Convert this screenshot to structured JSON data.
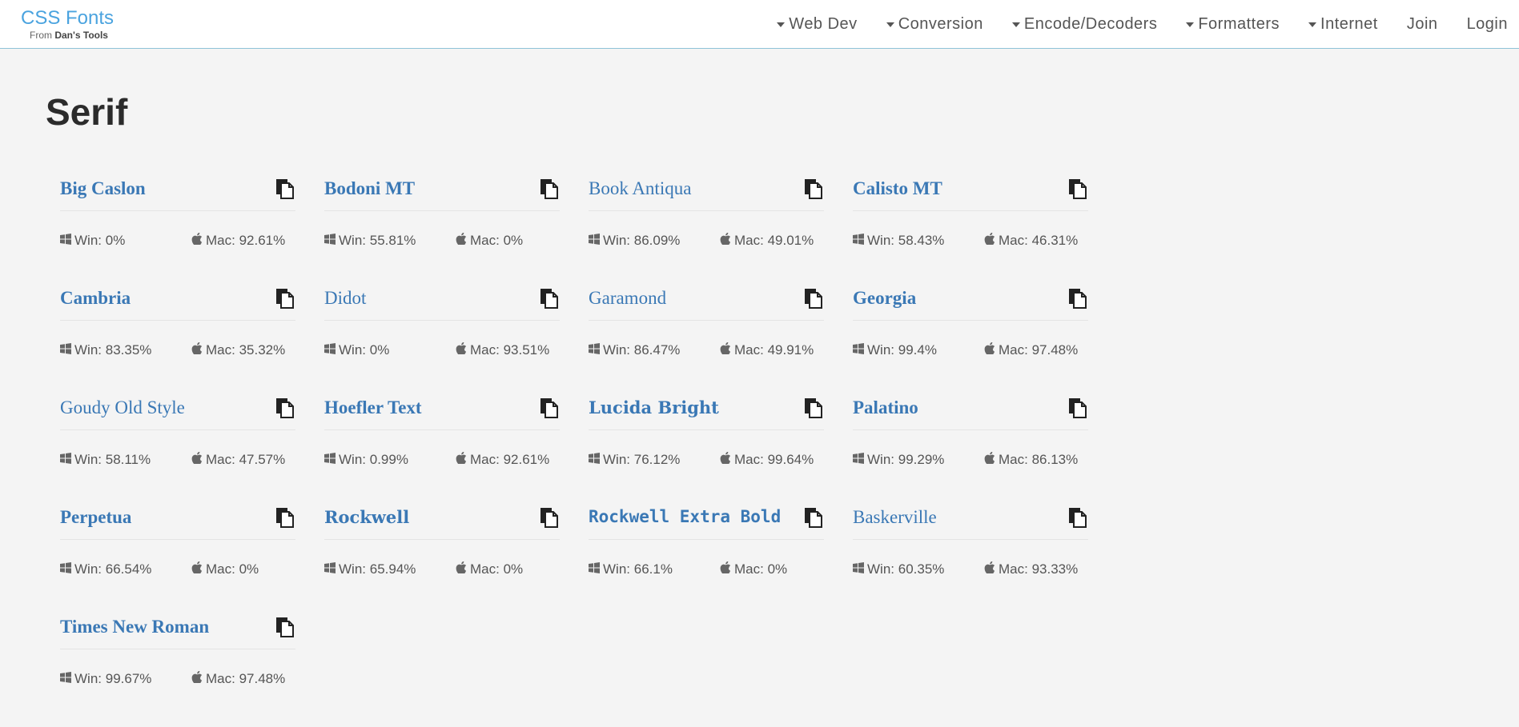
{
  "brand": {
    "title": "CSS Fonts",
    "from": "From",
    "site": "Dan's Tools"
  },
  "nav": [
    {
      "label": "Web Dev",
      "dropdown": true
    },
    {
      "label": "Conversion",
      "dropdown": true
    },
    {
      "label": "Encode/Decoders",
      "dropdown": true
    },
    {
      "label": "Formatters",
      "dropdown": true
    },
    {
      "label": "Internet",
      "dropdown": true
    },
    {
      "label": "Join",
      "dropdown": false
    },
    {
      "label": "Login",
      "dropdown": false
    }
  ],
  "page": {
    "title": "Serif"
  },
  "stat_labels": {
    "win": "Win:",
    "mac": "Mac:"
  },
  "fonts": [
    {
      "name": "Big Caslon",
      "win": "0%",
      "mac": "92.61%",
      "style": "f-serif"
    },
    {
      "name": "Bodoni MT",
      "win": "55.81%",
      "mac": "0%",
      "style": "f-serif"
    },
    {
      "name": "Book Antiqua",
      "win": "86.09%",
      "mac": "49.01%",
      "style": "f-serif-n"
    },
    {
      "name": "Calisto MT",
      "win": "58.43%",
      "mac": "46.31%",
      "style": "f-serif"
    },
    {
      "name": "Cambria",
      "win": "83.35%",
      "mac": "35.32%",
      "style": "f-serif"
    },
    {
      "name": "Didot",
      "win": "0%",
      "mac": "93.51%",
      "style": "f-serif-n"
    },
    {
      "name": "Garamond",
      "win": "86.47%",
      "mac": "49.91%",
      "style": "f-serif-n"
    },
    {
      "name": "Georgia",
      "win": "99.4%",
      "mac": "97.48%",
      "style": "f-serif"
    },
    {
      "name": "Goudy Old Style",
      "win": "58.11%",
      "mac": "47.57%",
      "style": "f-serif-n"
    },
    {
      "name": "Hoefler Text",
      "win": "0.99%",
      "mac": "92.61%",
      "style": "f-serif"
    },
    {
      "name": "Lucida Bright",
      "win": "76.12%",
      "mac": "99.64%",
      "style": "f-dserif-b"
    },
    {
      "name": "Palatino",
      "win": "99.29%",
      "mac": "86.13%",
      "style": "f-serif"
    },
    {
      "name": "Perpetua",
      "win": "66.54%",
      "mac": "0%",
      "style": "f-serif"
    },
    {
      "name": "Rockwell",
      "win": "65.94%",
      "mac": "0%",
      "style": "f-dserif-b"
    },
    {
      "name": "Rockwell Extra Bold",
      "win": "66.1%",
      "mac": "0%",
      "style": "f-mono"
    },
    {
      "name": "Baskerville",
      "win": "60.35%",
      "mac": "93.33%",
      "style": "f-serif-n"
    },
    {
      "name": "Times New Roman",
      "win": "99.67%",
      "mac": "97.48%",
      "style": "f-serif"
    }
  ],
  "icons": {
    "copy": "copy-icon",
    "windows": "windows-icon",
    "apple": "apple-icon"
  },
  "colors": {
    "link": "#3a78b5",
    "brand": "#4aa3df",
    "background": "#f4f4f4"
  }
}
